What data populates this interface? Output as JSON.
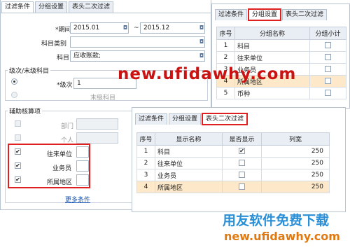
{
  "panel1": {
    "tabs": [
      "过滤条件",
      "分组设置",
      "表头二次过滤"
    ],
    "period_label": "*期间",
    "period_from": "2015.01",
    "period_sep": "~",
    "period_to": "2015.12",
    "subject_type_label": "科目类别",
    "subject_label": "科目",
    "subject_value": "应收账款;",
    "level_group_title": "级次/末级科目",
    "level_label": "*级次",
    "level_value": "1",
    "last_level_label": "末级科目",
    "aux_group_title": "辅助核算项",
    "aux_items": [
      {
        "label": "部门",
        "checked": false,
        "disabled": true
      },
      {
        "label": "个人",
        "checked": false,
        "disabled": true
      },
      {
        "label": "往来单位",
        "checked": true,
        "disabled": false
      },
      {
        "label": "业务员",
        "checked": true,
        "disabled": false
      },
      {
        "label": "所属地区",
        "checked": true,
        "disabled": false
      }
    ],
    "more_conditions": "更多条件"
  },
  "panel2": {
    "tabs": [
      "过滤条件",
      "分组设置",
      "表头二次过滤"
    ],
    "headers": [
      "序号",
      "分组名称",
      "分组小计"
    ],
    "rows": [
      {
        "no": "1",
        "name": "科目"
      },
      {
        "no": "2",
        "name": "往来单位"
      },
      {
        "no": "3",
        "name": "业务员"
      },
      {
        "no": "4",
        "name": "所属地区"
      },
      {
        "no": "5",
        "name": "币种"
      }
    ]
  },
  "panel3": {
    "tabs": [
      "过滤条件",
      "分组设置",
      "表头二次过滤"
    ],
    "headers": [
      "序号",
      "显示名称",
      "是否显示",
      "列宽"
    ],
    "rows": [
      {
        "no": "1",
        "name": "科目",
        "show": true,
        "width": "250"
      },
      {
        "no": "2",
        "name": "往来单位",
        "show": false,
        "width": "250"
      },
      {
        "no": "3",
        "name": "业务员",
        "show": false,
        "width": "250"
      },
      {
        "no": "4",
        "name": "所属地区",
        "show": false,
        "width": "250"
      }
    ]
  },
  "watermark": {
    "center_text": "new.ufidawhy.com",
    "bottom_cn": "用友软件免费下载",
    "bottom_url": "new.ufidawhy.com"
  },
  "colors": {
    "highlight": "#e02020",
    "watermark_red": "#cc1111",
    "watermark_blue": "#2a8fd6",
    "selected_row": "#fde9c9"
  }
}
